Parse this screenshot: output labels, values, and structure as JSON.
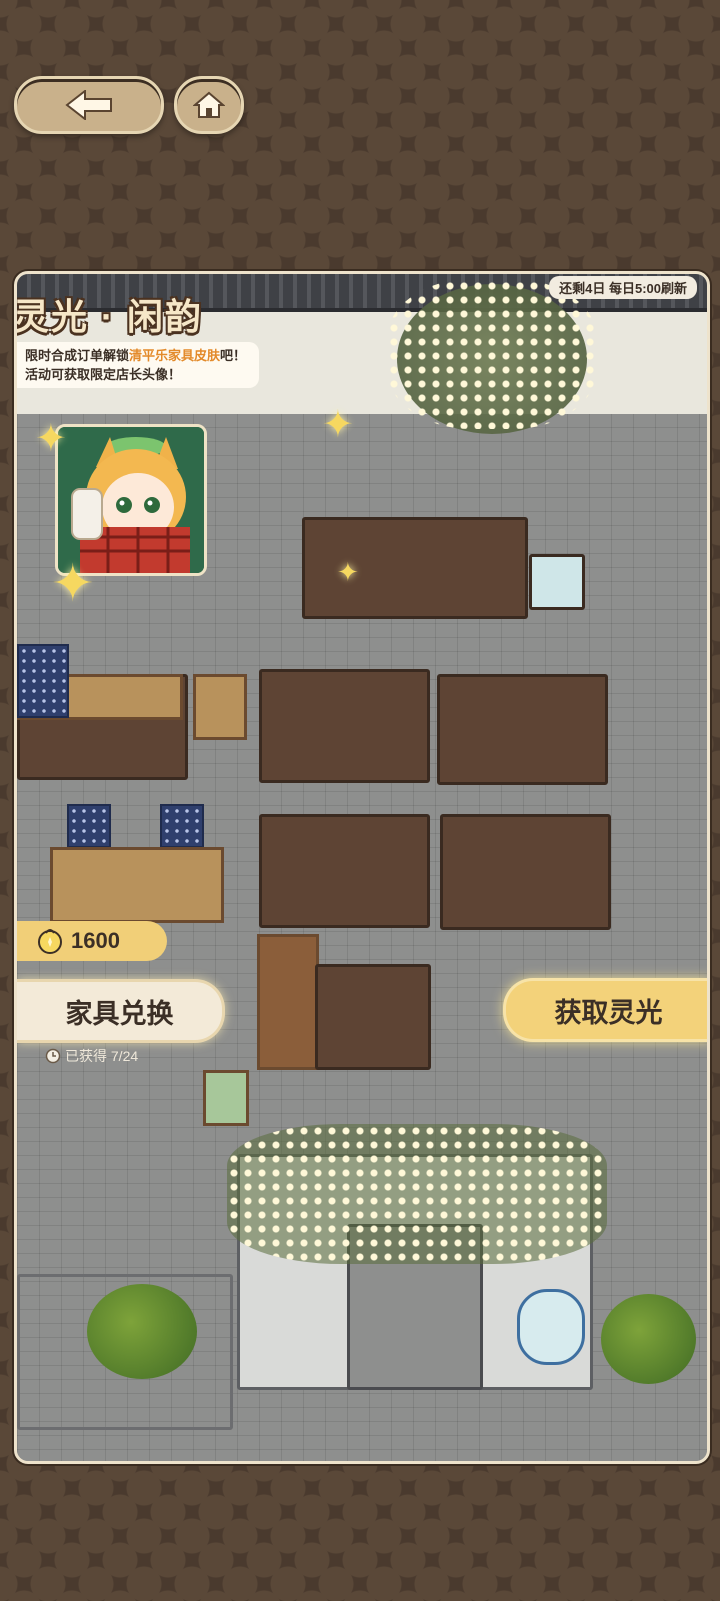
{
  "nav": {
    "back_icon": "arrow-left-icon",
    "home_icon": "home-icon"
  },
  "event": {
    "timer": "还剩4日 每日5:00刷新",
    "title": "灵光 · 闲韵",
    "desc_pre": "限时合成订单解锁",
    "desc_highlight": "清平乐家具皮肤",
    "desc_post": "吧！活动可获取限定店长头像！"
  },
  "currency": {
    "icon": "gold-coin-icon",
    "amount": "1600"
  },
  "actions": {
    "exchange_label": "家具兑换",
    "get_light_label": "获取灵光",
    "progress": "已获得 7/24"
  },
  "colors": {
    "accent": "#f3d27a",
    "highlight": "#e38a2a",
    "frame": "#c9b18b"
  }
}
